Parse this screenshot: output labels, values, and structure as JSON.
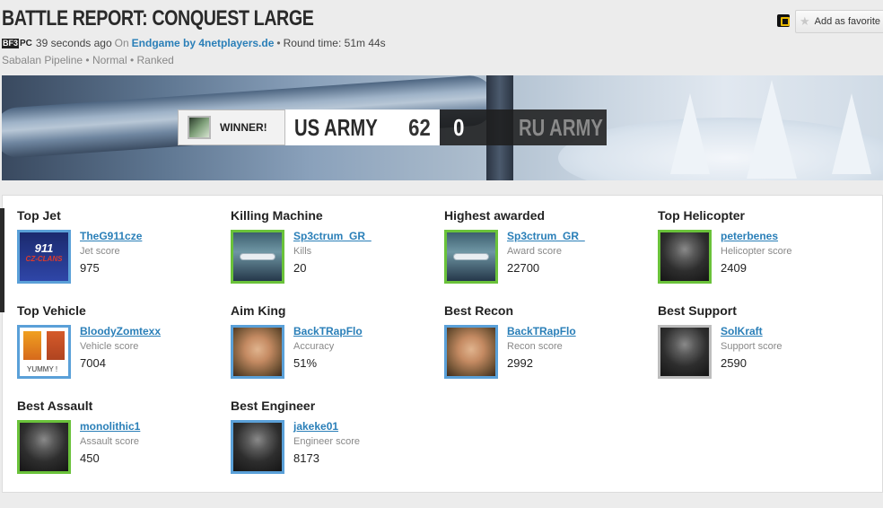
{
  "header": {
    "title": "BATTLE REPORT: CONQUEST LARGE",
    "game_badge": "BF3",
    "platform": "PC",
    "time_ago": "39 seconds ago",
    "on_label": "On",
    "server": "Endgame by 4netplayers.de",
    "round_time": "Round time: 51m 44s",
    "map_info": "Sabalan Pipeline • Normal • Ranked",
    "favorite_label": "Add as favorite"
  },
  "score": {
    "winner_label": "WINNER!",
    "team1": {
      "name": "US ARMY",
      "score": "62"
    },
    "team2": {
      "name": "RU ARMY",
      "score": "0"
    }
  },
  "awards": [
    {
      "category": "Top Jet",
      "player": "TheG911cze",
      "label": "Jet score",
      "value": "975",
      "avatar": "g911-logo",
      "border": "blue"
    },
    {
      "category": "Killing Machine",
      "player": "Sp3ctrum_GR_",
      "label": "Kills",
      "value": "20",
      "avatar": "jet-photo",
      "border": "green"
    },
    {
      "category": "Highest awarded",
      "player": "Sp3ctrum_GR_",
      "label": "Award score",
      "value": "22700",
      "avatar": "jet-photo",
      "border": "green"
    },
    {
      "category": "Top Helicopter",
      "player": "peterbenes",
      "label": "Helicopter score",
      "value": "2409",
      "avatar": "soldier",
      "border": "green"
    },
    {
      "category": "Top Vehicle",
      "player": "BloodyZomtexx",
      "label": "Vehicle score",
      "value": "7004",
      "avatar": "yummy",
      "border": "blue",
      "avatar_text": "YUMMY !"
    },
    {
      "category": "Aim King",
      "player": "BackTRapFlo",
      "label": "Accuracy",
      "value": "51%",
      "avatar": "face",
      "border": "blue"
    },
    {
      "category": "Best Recon",
      "player": "BackTRapFlo",
      "label": "Recon score",
      "value": "2992",
      "avatar": "face",
      "border": "blue"
    },
    {
      "category": "Best Support",
      "player": "SolKraft",
      "label": "Support score",
      "value": "2590",
      "avatar": "soldier",
      "border": "grey"
    },
    {
      "category": "Best Assault",
      "player": "monolithic1",
      "label": "Assault score",
      "value": "450",
      "avatar": "soldier",
      "border": "green"
    },
    {
      "category": "Best Engineer",
      "player": "jakeke01",
      "label": "Engineer score",
      "value": "8173",
      "avatar": "soldier",
      "border": "blue"
    }
  ],
  "g911_logo": {
    "top": "911",
    "bottom": "CZ-CLANS"
  },
  "colors": {
    "link": "#2a7fb8",
    "green_border": "#6ac23a",
    "blue_border": "#5aa0d8",
    "grey_border": "#bdbdbd"
  }
}
